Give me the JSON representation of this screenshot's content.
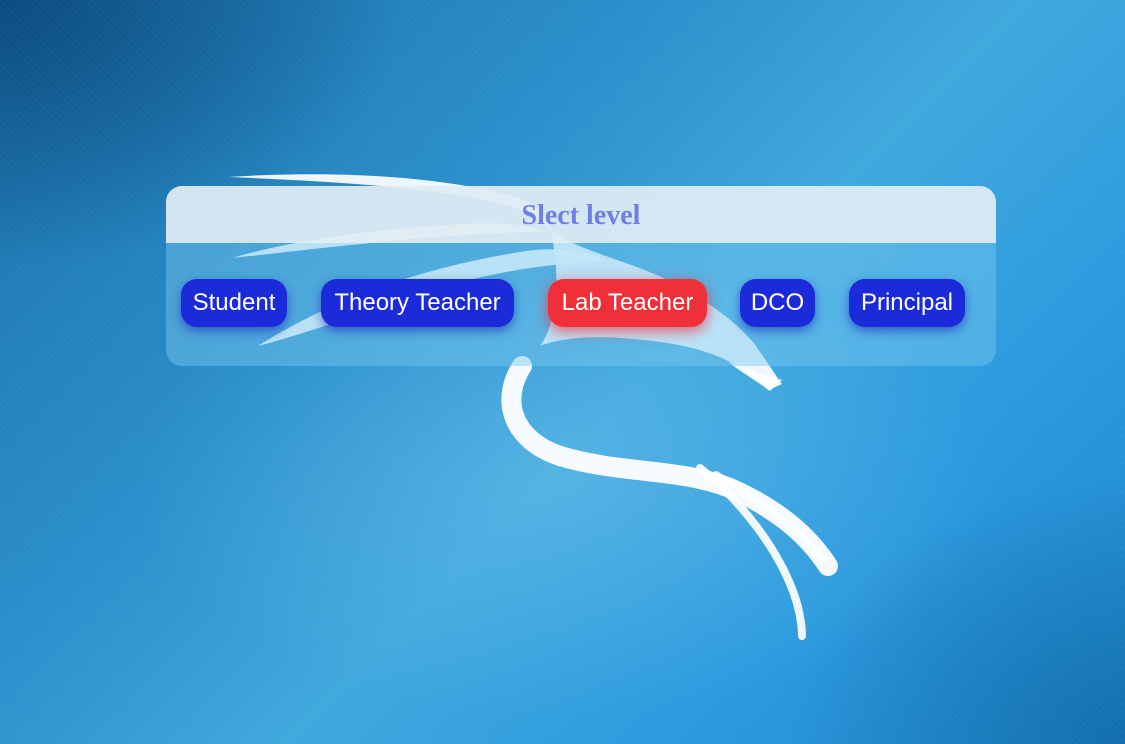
{
  "background": {
    "theme_colors": [
      "#1a6fa8",
      "#2a8fcb",
      "#3fa8dd"
    ],
    "logo_icon": "kali-dragon-icon"
  },
  "panel": {
    "title": "Slect level",
    "title_color": "#6f7fe6",
    "buttons": [
      {
        "label": "Student",
        "active": false
      },
      {
        "label": "Theory Teacher",
        "active": false
      },
      {
        "label": "Lab Teacher",
        "active": true
      },
      {
        "label": "DCO",
        "active": false
      },
      {
        "label": "Principal",
        "active": false
      }
    ],
    "button_color": "#1c2bd9",
    "active_button_color": "#ef3038"
  }
}
